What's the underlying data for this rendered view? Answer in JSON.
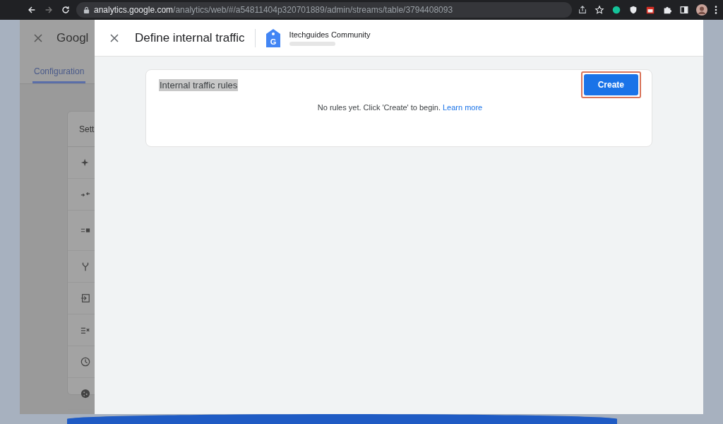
{
  "browser": {
    "url_host": "analytics.google.com",
    "url_path": "/analytics/web/#/a54811404p320701889/admin/streams/table/3794408093"
  },
  "background_page": {
    "title": "Googl",
    "tabs": [
      {
        "label": "Configuration",
        "selected": true
      }
    ],
    "settings_card": {
      "title": "Sett"
    }
  },
  "drawer": {
    "title": "Define internal traffic",
    "account": {
      "logo_letter": "G",
      "name": "Itechguides Community"
    },
    "card": {
      "title": "Internal traffic rules",
      "title_highlighted": true,
      "empty_message": "No rules yet. Click 'Create' to begin.",
      "link": "Learn more",
      "button": {
        "label": "Create",
        "highlighted": true
      }
    }
  }
}
